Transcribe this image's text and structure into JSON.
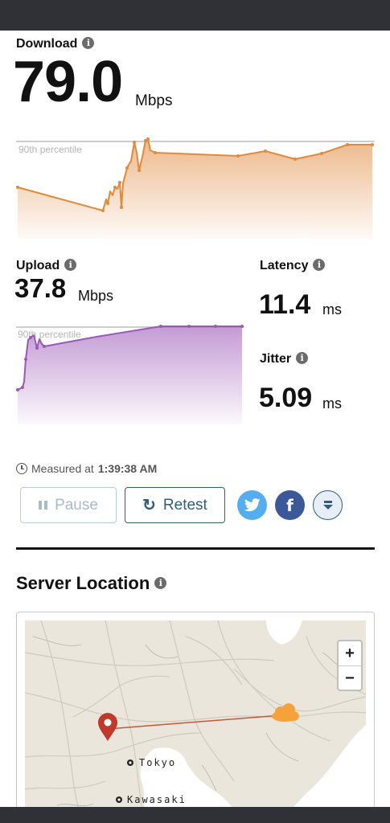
{
  "download": {
    "label": "Download",
    "value": "79.0",
    "unit": "Mbps"
  },
  "upload": {
    "label": "Upload",
    "value": "37.8",
    "unit": "Mbps"
  },
  "latency": {
    "label": "Latency",
    "value": "11.4",
    "unit": "ms"
  },
  "jitter": {
    "label": "Jitter",
    "value": "5.09",
    "unit": "ms"
  },
  "charts": {
    "percentile_label": "90th percentile"
  },
  "colors": {
    "download": "#e08a3e",
    "upload": "#9b59b6",
    "accent": "#2f5e7f",
    "twitter": "#55acee",
    "facebook": "#3b5998",
    "map_pin": "#c0392b"
  },
  "measured": {
    "prefix": "Measured at",
    "time": "1:39:38 AM"
  },
  "actions": {
    "pause_label": "Pause",
    "retest_label": "Retest"
  },
  "share": {
    "twitter": "twitter-icon",
    "facebook": "facebook-icon",
    "download": "download-icon"
  },
  "server": {
    "title": "Server Location"
  },
  "map": {
    "zoom_in": "+",
    "zoom_out": "−",
    "labels": {
      "city1": "Tokyo",
      "city2": "Kawasaki"
    }
  }
}
